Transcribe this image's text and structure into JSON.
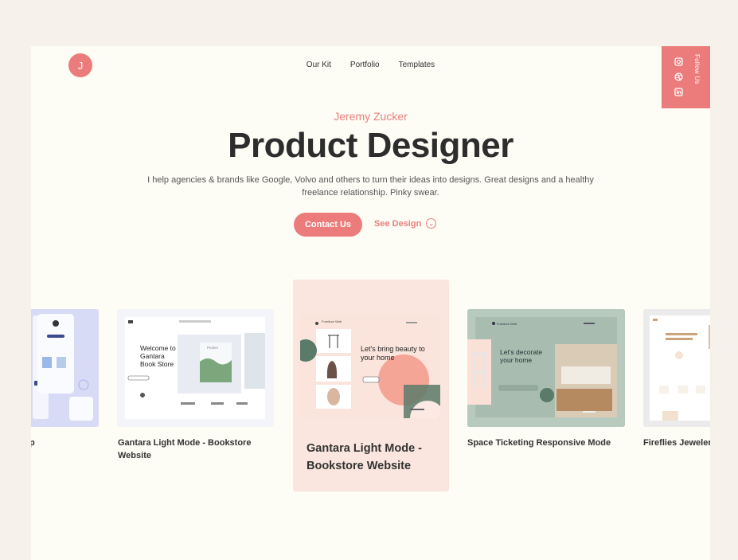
{
  "logo": {
    "letter": "J"
  },
  "nav": {
    "items": [
      "Our Kit",
      "Portfolio",
      "Templates"
    ]
  },
  "follow": {
    "label": "Follow Us",
    "icons": [
      "instagram-icon",
      "dribbble-icon",
      "linkedin-icon"
    ]
  },
  "hero": {
    "name": "Jeremy Zucker",
    "title": "Product Designer",
    "description": "I help agencies & brands like Google, Volvo and others to turn their ideas into designs. Great designs and a healthy freelance relationship. Pinky swear.",
    "contact_label": "Contact Us",
    "see_design_label": "See Design"
  },
  "projects": [
    {
      "title": "p"
    },
    {
      "title": "Gantara Light Mode - Bookstore Website",
      "mock": {
        "heading": "Welcome to Gantara Book Store",
        "book": "Ptolem"
      }
    },
    {
      "title": "Gantara Light Mode - Bookstore Website",
      "mock": {
        "heading": "Let's bring beauty to your home",
        "brand": "Furniture Web"
      }
    },
    {
      "title": "Space Ticketing Responsive Mode",
      "mock": {
        "heading": "Let's decorate your home",
        "brand": "Furniture Web"
      }
    },
    {
      "title": "Fireflies Jeweler"
    }
  ],
  "colors": {
    "accent": "#ec7b7b",
    "background": "#fdfcf5",
    "outer": "#f6f1ea"
  }
}
